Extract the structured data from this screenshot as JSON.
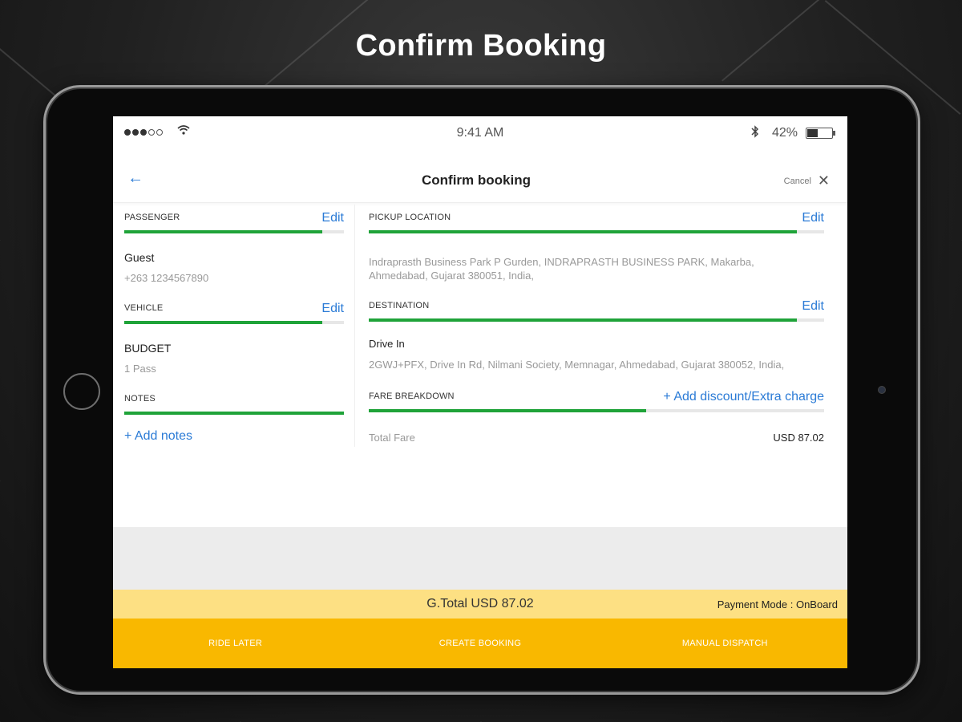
{
  "hero": {
    "title": "Confirm Booking"
  },
  "status_bar": {
    "time": "9:41 AM",
    "battery_percent": "42%",
    "battery_level": 0.42,
    "wifi_icon": "wifi-icon",
    "bluetooth_icon": "bluetooth-icon"
  },
  "nav": {
    "back_icon": "←",
    "title": "Confirm booking",
    "cancel_label": "Cancel",
    "close_icon": "✕"
  },
  "passenger": {
    "label": "PASSENGER",
    "edit": "Edit",
    "name": "Guest",
    "phone": "+263 1234567890",
    "progress": 0.9
  },
  "vehicle": {
    "label": "VEHICLE",
    "edit": "Edit",
    "type": "BUDGET",
    "capacity": "1 Pass",
    "progress": 0.9
  },
  "notes": {
    "label": "NOTES",
    "add": "+ Add notes",
    "progress": 1.0
  },
  "pickup": {
    "label": "PICKUP LOCATION",
    "edit": "Edit",
    "address_line1": "Indraprasth Business Park P Gurden, INDRAPRASTH BUSINESS PARK, Makarba,",
    "address_line2": "Ahmedabad, Gujarat 380051, India,",
    "progress": 0.94
  },
  "destination": {
    "label": "DESTINATION",
    "edit": "Edit",
    "name": "Drive In",
    "address": "2GWJ+PFX, Drive In Rd, Nilmani Society, Memnagar, Ahmedabad, Gujarat 380052, India,",
    "progress": 0.94
  },
  "fare": {
    "label": "FARE BREAKDOWN",
    "add": "+ Add discount/Extra charge",
    "progress": 0.61,
    "total_label": "Total Fare",
    "total_value": "USD 87.02"
  },
  "summary": {
    "grand_total": "G.Total USD 87.02",
    "payment_mode": "Payment Mode : OnBoard"
  },
  "actions": {
    "ride_later": "RIDE LATER",
    "create_booking": "CREATE BOOKING",
    "manual_dispatch": "MANUAL DISPATCH"
  },
  "colors": {
    "accent_blue": "#2b7bd6",
    "progress_green": "#1fa339",
    "total_strip": "#fde083",
    "action_bar": "#f9b800"
  }
}
